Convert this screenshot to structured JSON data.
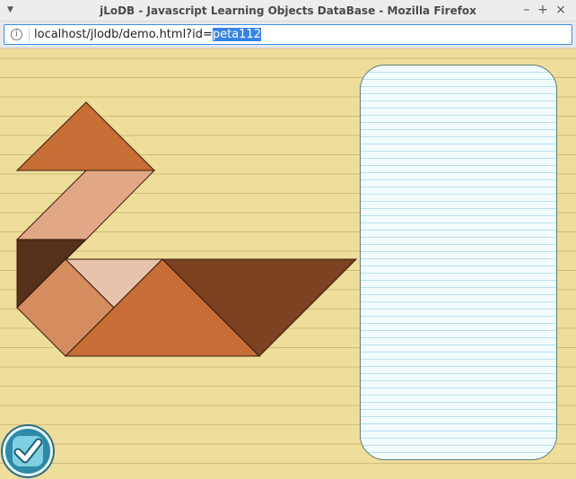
{
  "window": {
    "title": "jLoDB - Javascript Learning Objects DataBase - Mozilla Firefox",
    "menu_icon": "chevron-down-icon",
    "controls": {
      "minimize": "–",
      "maximize": "+",
      "close": "×"
    }
  },
  "urlbar": {
    "info_glyph": "i",
    "url_prefix": "localhost/jlodb/demo.html?id=",
    "url_selected": "peta112"
  },
  "colors": {
    "page_bg": "#efdd9b",
    "ruled_line": "#cfbd7a",
    "notepad_bg": "#f2fcfd",
    "notepad_line": "#b9e0ec",
    "check_button": "#2e8aa7",
    "tangram": {
      "top_triangle": "#c66e36",
      "parallelogram": "#e0a887",
      "small_dark_triangle": "#55301a",
      "square": "#d58c5f",
      "small_light_triangle": "#e8c3ab",
      "large_center_triangle": "#c66e36",
      "large_right_triangle": "#7b4322"
    }
  },
  "tangram_pieces": [
    "top-triangle",
    "parallelogram",
    "small-dark-triangle",
    "square",
    "small-light-triangle",
    "large-center-triangle",
    "large-right-triangle"
  ],
  "check_button": {
    "icon": "checkmark-icon"
  }
}
